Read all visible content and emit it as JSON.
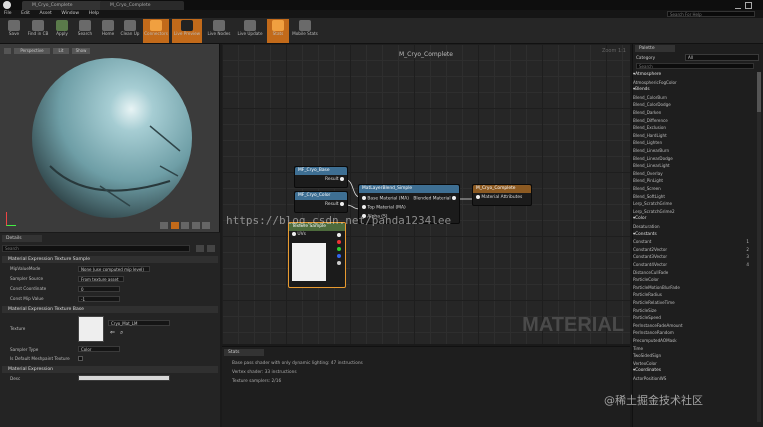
{
  "window": {
    "tabs": [
      "M_Cryo_Complete",
      "M_Cryo_Complete"
    ],
    "search_placeholder": "Search For Help"
  },
  "menu": [
    "File",
    "Edit",
    "Asset",
    "Window",
    "Help"
  ],
  "toolbar": [
    "Save",
    "Find in CB",
    "Apply",
    "Search",
    "Home",
    "Clean Up",
    "Connectors",
    "Live Preview",
    "Live Nodes",
    "Live Update",
    "Stats",
    "Mobile Stats"
  ],
  "viewport": {
    "perspective_label": "Perspective",
    "lit_label": "Lit",
    "show_label": "Show"
  },
  "details": {
    "tab_label": "Details",
    "search_placeholder": "Search",
    "sections": {
      "texture_sample": "Material Expression Texture Sample",
      "texture_base": "Material Expression Texture Base",
      "expression": "Material Expression"
    },
    "props": {
      "mipvalue_mode_label": "MipValueMode",
      "mipvalue_mode_value": "None (use computed mip level)",
      "sampler_source_label": "Sampler Source",
      "sampler_source_value": "From texture asset",
      "const_coordinate_label": "Const Coordinate",
      "const_coordinate_value": "0",
      "const_mip_value_label": "Const Mip Value",
      "const_mip_value_value": "-1",
      "texture_label": "Texture",
      "texture_value": "Cryo_Mat_LM",
      "sampler_type_label": "Sampler Type",
      "sampler_type_value": "Color",
      "default_meshpaint_label": "Is Default Meshpaint Texture",
      "desc_label": "Desc"
    }
  },
  "graph": {
    "title": "M_Cryo_Complete",
    "zoom": "Zoom 1:1",
    "watermark": "MATERIAL",
    "nodes": {
      "base": {
        "title": "MF_Cryo_Base",
        "pin": "Result"
      },
      "color": {
        "title": "MF_Cryo_Color",
        "pin": "Result"
      },
      "blend": {
        "title": "MatLayerBlend_Simple",
        "in1": "Base Material (MA)",
        "in2": "Top Material (MA)",
        "in3": "Alpha (S)",
        "out": "Blended Material"
      },
      "complete": {
        "title": "M_Cryo_Complete",
        "in": "Material Attributes"
      },
      "texture": {
        "title": "Texture Sample",
        "pin": "UVs"
      }
    }
  },
  "stats": {
    "tab_label": "Stats",
    "lines": [
      "Base pass shader with only dynamic lighting: 47 instructions",
      "Vertex shader: 33 instructions",
      "Texture samplers: 2/16"
    ]
  },
  "palette": {
    "tab_label": "Palette",
    "category_label": "Category",
    "category_value": "All",
    "search_placeholder": "Search",
    "entries": [
      {
        "cat": "Atmosphere"
      },
      {
        "item": "AtmosphericFogColor"
      },
      {
        "cat": "Blends"
      },
      {
        "item": "Blend_ColorBurn"
      },
      {
        "item": "Blend_ColorDodge"
      },
      {
        "item": "Blend_Darken"
      },
      {
        "item": "Blend_Difference"
      },
      {
        "item": "Blend_Exclusion"
      },
      {
        "item": "Blend_HardLight"
      },
      {
        "item": "Blend_Lighten"
      },
      {
        "item": "Blend_LinearBurn"
      },
      {
        "item": "Blend_LinearDodge"
      },
      {
        "item": "Blend_LinearLight"
      },
      {
        "item": "Blend_Overlay"
      },
      {
        "item": "Blend_PinLight"
      },
      {
        "item": "Blend_Screen"
      },
      {
        "item": "Blend_SoftLight"
      },
      {
        "item": "Lerp_ScratchGrime"
      },
      {
        "item": "Lerp_ScratchGrime2"
      },
      {
        "cat": "Color"
      },
      {
        "item": "Desaturation"
      },
      {
        "cat": "Constants"
      },
      {
        "item": "Constant",
        "key": "1"
      },
      {
        "item": "Constant2Vector",
        "key": "2"
      },
      {
        "item": "Constant3Vector",
        "key": "3"
      },
      {
        "item": "Constant4Vector",
        "key": "4"
      },
      {
        "item": "DistanceCullFade"
      },
      {
        "item": "ParticleColor"
      },
      {
        "item": "ParticleMotionBlurFade"
      },
      {
        "item": "ParticleRadius"
      },
      {
        "item": "ParticleRelativeTime"
      },
      {
        "item": "ParticleSize"
      },
      {
        "item": "ParticleSpeed"
      },
      {
        "item": "PerInstanceFadeAmount"
      },
      {
        "item": "PerInstanceRandom"
      },
      {
        "item": "PrecomputedAOMask"
      },
      {
        "item": "Time"
      },
      {
        "item": "TwoSidedSign"
      },
      {
        "item": "VertexColor"
      },
      {
        "cat": "Coordinates"
      },
      {
        "item": "ActorPositionWS"
      }
    ]
  },
  "overlay_watermark": "https://blog.csdn.net/panda1234lee",
  "corner_watermark": "@稀土掘金技术社区",
  "colors": {
    "accent": "#c26a1a",
    "node_blue": "#3e6f93",
    "node_orange": "#8c5a22",
    "node_green": "#4d6b3c"
  }
}
